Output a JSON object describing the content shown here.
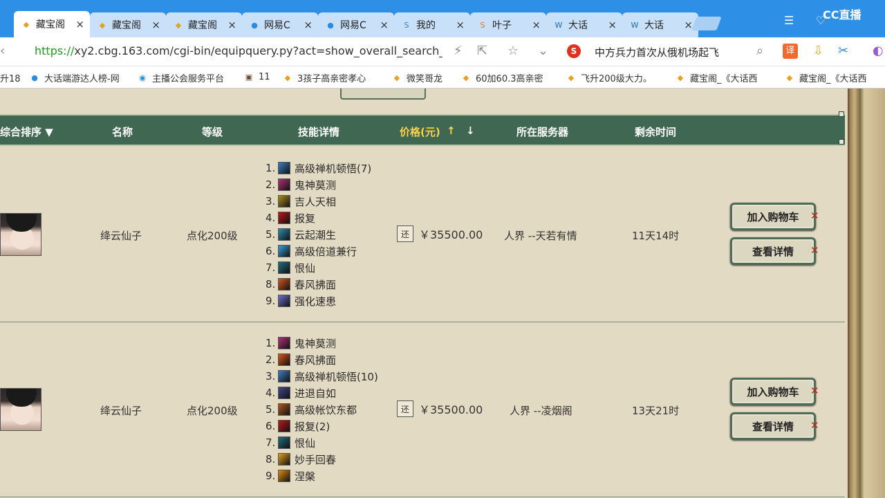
{
  "browser": {
    "tabs": [
      {
        "label": "藏宝阁",
        "icon": "cbg-icon",
        "active": true
      },
      {
        "label": "藏宝阁",
        "icon": "cbg-icon"
      },
      {
        "label": "藏宝阁",
        "icon": "cbg-icon"
      },
      {
        "label": "网易C",
        "icon": "netease-icon"
      },
      {
        "label": "网易C",
        "icon": "netease-icon"
      },
      {
        "label": "我的",
        "icon": "s-icon"
      },
      {
        "label": "叶子",
        "icon": "sogou-icon"
      },
      {
        "label": "大话",
        "icon": "dh-icon"
      },
      {
        "label": "大话",
        "icon": "dh-icon"
      }
    ],
    "tab_close": "×",
    "brand": "CC直播",
    "url": {
      "protocol": "https://",
      "rest": "xy2.cbg.163.com/cgi-bin/equipquery.py?act=show_overall_search_"
    },
    "search_text": "中方兵力首次从俄机场起飞",
    "bookmarks": [
      {
        "label": "升18",
        "icon": "none"
      },
      {
        "label": "大话端游达人榜-网",
        "icon": "netease-icon"
      },
      {
        "label": "主播公会服务平台",
        "icon": "cc-icon"
      },
      {
        "label": "11",
        "icon": "img-icon"
      },
      {
        "label": "3孩子高亲密孝心",
        "icon": "cbg-icon"
      },
      {
        "label": "微笑哥龙",
        "icon": "cbg-icon"
      },
      {
        "label": "60加60.3高亲密",
        "icon": "cbg-icon"
      },
      {
        "label": "飞升200级大力。",
        "icon": "cbg-icon"
      },
      {
        "label": "藏宝阁_《大话西",
        "icon": "cbg-icon"
      },
      {
        "label": "藏宝阁_《大话西",
        "icon": "cbg-icon"
      }
    ]
  },
  "table": {
    "headers": {
      "sort": "综合排序 ▼",
      "name": "名称",
      "level": "等级",
      "skills": "技能详情",
      "price": "价格(元)",
      "price_up": "↑",
      "price_down": "↓",
      "server": "所在服务器",
      "time": "剩余时间"
    },
    "rows": [
      {
        "name": "绛云仙子",
        "level": "点化200级",
        "price_tag": "还",
        "price": "￥35500.00",
        "server": "人界 --天若有情",
        "time": "11天14时",
        "skills": [
          {
            "n": "1.",
            "label": "高级禅机顿悟(7)",
            "color": "#3a7fc2"
          },
          {
            "n": "2.",
            "label": "鬼神莫测",
            "color": "#b2307a"
          },
          {
            "n": "3.",
            "label": "吉人天相",
            "color": "#b08a20"
          },
          {
            "n": "4.",
            "label": "报复",
            "color": "#c01818"
          },
          {
            "n": "5.",
            "label": "云起潮生",
            "color": "#2a8db0"
          },
          {
            "n": "6.",
            "label": "高级倍道兼行",
            "color": "#3aa0d8"
          },
          {
            "n": "7.",
            "label": "恨仙",
            "color": "#1f6f7e"
          },
          {
            "n": "8.",
            "label": "春风拂面",
            "color": "#d85818"
          },
          {
            "n": "9.",
            "label": "强化速患",
            "color": "#7070d0"
          }
        ]
      },
      {
        "name": "绛云仙子",
        "level": "点化200级",
        "price_tag": "还",
        "price": "￥35500.00",
        "server": "人界 --凌烟阁",
        "time": "13天21时",
        "skills": [
          {
            "n": "1.",
            "label": "鬼神莫测",
            "color": "#b2307a"
          },
          {
            "n": "2.",
            "label": "春风拂面",
            "color": "#d85818"
          },
          {
            "n": "3.",
            "label": "高级禅机顿悟(10)",
            "color": "#3a7fc2"
          },
          {
            "n": "4.",
            "label": "进退自如",
            "color": "#404a8a"
          },
          {
            "n": "5.",
            "label": "高级帐饮东都",
            "color": "#b05a20"
          },
          {
            "n": "6.",
            "label": "报复(2)",
            "color": "#c01818"
          },
          {
            "n": "7.",
            "label": "恨仙",
            "color": "#1f6f7e"
          },
          {
            "n": "8.",
            "label": "妙手回春",
            "color": "#e0a020"
          },
          {
            "n": "9.",
            "label": "涅槃",
            "color": "#e08a10"
          }
        ]
      }
    ],
    "buttons": {
      "add_cart": "加入购物车",
      "details": "查看详情",
      "mark": "✕"
    }
  }
}
